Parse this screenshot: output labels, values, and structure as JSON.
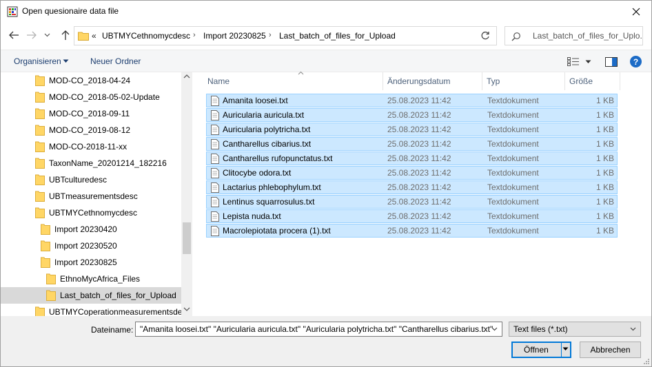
{
  "window": {
    "title": "Open quesionaire data file"
  },
  "address": {
    "overflow": "«",
    "crumbs": [
      "UBTMYCethnomycdesc",
      "Import 20230825",
      "Last_batch_of_files_for_Upload"
    ]
  },
  "search": {
    "placeholder": "Last_batch_of_files_for_Uplo..."
  },
  "toolbar": {
    "organize_label": "Organisieren",
    "new_folder_label": "Neuer Ordner"
  },
  "tree": [
    {
      "label": "MOD-CO_2018-04-24",
      "level": 1
    },
    {
      "label": "MOD-CO_2018-05-02-Update",
      "level": 1
    },
    {
      "label": "MOD-CO_2018-09-11",
      "level": 1
    },
    {
      "label": "MOD-CO_2019-08-12",
      "level": 1
    },
    {
      "label": "MOD-CO-2018-11-xx",
      "level": 1
    },
    {
      "label": "TaxonName_20201214_182216",
      "level": 1
    },
    {
      "label": "UBTculturedesc",
      "level": 1
    },
    {
      "label": "UBTmeasurementsdesc",
      "level": 1
    },
    {
      "label": "UBTMYCethnomycdesc",
      "level": 1
    },
    {
      "label": "Import 20230420",
      "level": 2
    },
    {
      "label": "Import 20230520",
      "level": 2
    },
    {
      "label": "Import 20230825",
      "level": 2
    },
    {
      "label": "EthnoMycAfrica_Files",
      "level": 3
    },
    {
      "label": "Last_batch_of_files_for_Upload",
      "level": 3,
      "selected": true
    },
    {
      "label": "UBTMYCoperationmeasurementsdes",
      "level": 1
    }
  ],
  "columns": {
    "name": "Name",
    "date": "Änderungsdatum",
    "type": "Typ",
    "size": "Größe"
  },
  "files": [
    {
      "name": "Amanita loosei.txt",
      "date": "25.08.2023 11:42",
      "type": "Textdokument",
      "size": "1 KB"
    },
    {
      "name": "Auricularia auricula.txt",
      "date": "25.08.2023 11:42",
      "type": "Textdokument",
      "size": "1 KB"
    },
    {
      "name": "Auricularia polytricha.txt",
      "date": "25.08.2023 11:42",
      "type": "Textdokument",
      "size": "1 KB"
    },
    {
      "name": "Cantharellus cibarius.txt",
      "date": "25.08.2023 11:42",
      "type": "Textdokument",
      "size": "1 KB"
    },
    {
      "name": "Cantharellus rufopunctatus.txt",
      "date": "25.08.2023 11:42",
      "type": "Textdokument",
      "size": "1 KB"
    },
    {
      "name": "Clitocybe odora.txt",
      "date": "25.08.2023 11:42",
      "type": "Textdokument",
      "size": "1 KB"
    },
    {
      "name": "Lactarius phlebophylum.txt",
      "date": "25.08.2023 11:42",
      "type": "Textdokument",
      "size": "1 KB"
    },
    {
      "name": "Lentinus squarrosulus.txt",
      "date": "25.08.2023 11:42",
      "type": "Textdokument",
      "size": "1 KB"
    },
    {
      "name": "Lepista nuda.txt",
      "date": "25.08.2023 11:42",
      "type": "Textdokument",
      "size": "1 KB"
    },
    {
      "name": "Macrolepiotata procera (1).txt",
      "date": "25.08.2023 11:42",
      "type": "Textdokument",
      "size": "1 KB"
    }
  ],
  "footer": {
    "filename_label": "Dateiname:",
    "filename_value": "\"Amanita loosei.txt\" \"Auricularia auricula.txt\" \"Auricularia polytricha.txt\" \"Cantharellus cibarius.txt\"",
    "filetype_value": "Text files (*.txt)",
    "open_label": "Öffnen",
    "cancel_label": "Abbrechen"
  },
  "colors": {
    "selection_fill": "#cce8ff",
    "selection_border": "#99d1ff",
    "folder_yellow": "#ffd665",
    "accent_blue": "#0078d7"
  }
}
